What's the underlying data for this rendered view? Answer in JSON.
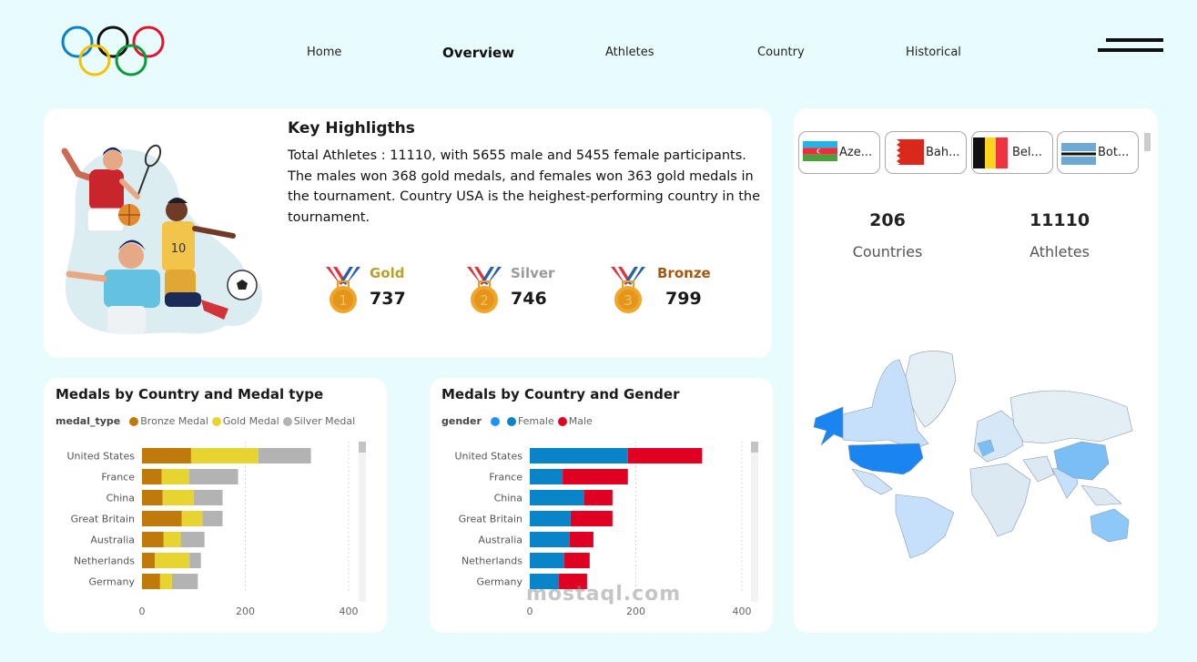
{
  "nav": {
    "items": [
      {
        "label": "Home",
        "active": false
      },
      {
        "label": "Overview",
        "active": true
      },
      {
        "label": "Athletes",
        "active": false
      },
      {
        "label": "Country",
        "active": false
      },
      {
        "label": "Historical",
        "active": false
      }
    ],
    "menu_icon": "hamburger-icon"
  },
  "highlights": {
    "title": "Key Highligths",
    "text": "Total Athletes : 11110, with 5655 male and 5455 female participants. The males won 368 gold medals, and females won 363 gold medals in the tournament. Country USA is the heighest-performing country in the tournament.",
    "medals": [
      {
        "label": "Gold",
        "value": "737",
        "number": "1",
        "color": "#b5a22e"
      },
      {
        "label": "Silver",
        "value": "746",
        "number": "2",
        "color": "#9a9a9a"
      },
      {
        "label": "Bronze",
        "value": "799",
        "number": "3",
        "color": "#a35a10"
      }
    ]
  },
  "country_slicer": [
    {
      "name": "Aze...",
      "flag": "azerbaijan"
    },
    {
      "name": "Bah...",
      "flag": "bahrain"
    },
    {
      "name": "Bel...",
      "flag": "belgium"
    },
    {
      "name": "Bot...",
      "flag": "botswana"
    }
  ],
  "kpis": [
    {
      "value": "206",
      "label": "Countries"
    },
    {
      "value": "11110",
      "label": "Athletes"
    }
  ],
  "watermark": "mostaql.com",
  "chart_data": [
    {
      "type": "bar",
      "orientation": "horizontal",
      "stacked": true,
      "title": "Medals by Country and Medal type",
      "legend_title": "medal_type",
      "legend_position": "top-left",
      "categories": [
        "United States",
        "France",
        "China",
        "Great Britain",
        "Australia",
        "Netherlands",
        "Germany"
      ],
      "series": [
        {
          "name": "Bronze Medal",
          "color": "#c07a0a",
          "values": [
            95,
            38,
            40,
            77,
            42,
            25,
            35
          ]
        },
        {
          "name": "Gold Medal",
          "color": "#e8d430",
          "values": [
            130,
            53,
            60,
            40,
            33,
            67,
            23
          ]
        },
        {
          "name": "Silver Medal",
          "color": "#b3b3b3",
          "values": [
            102,
            95,
            56,
            39,
            46,
            22,
            50
          ]
        }
      ],
      "xticks": [
        0,
        200,
        400
      ],
      "xlim": [
        0,
        400
      ],
      "grid": true
    },
    {
      "type": "bar",
      "orientation": "horizontal",
      "stacked": true,
      "title": "Medals by Country and Gender",
      "legend_title": "gender",
      "legend_position": "top-left",
      "legend_extra_dot": "#1e90ff",
      "categories": [
        "United States",
        "France",
        "China",
        "Great Britain",
        "Australia",
        "Netherlands",
        "Germany"
      ],
      "series": [
        {
          "name": "Female",
          "color": "#0a84c8",
          "values": [
            185,
            62,
            103,
            77,
            75,
            65,
            55
          ]
        },
        {
          "name": "Male",
          "color": "#e00022",
          "values": [
            140,
            123,
            53,
            79,
            45,
            48,
            53
          ]
        }
      ],
      "xticks": [
        0,
        200,
        400
      ],
      "xlim": [
        0,
        400
      ],
      "grid": true
    }
  ]
}
